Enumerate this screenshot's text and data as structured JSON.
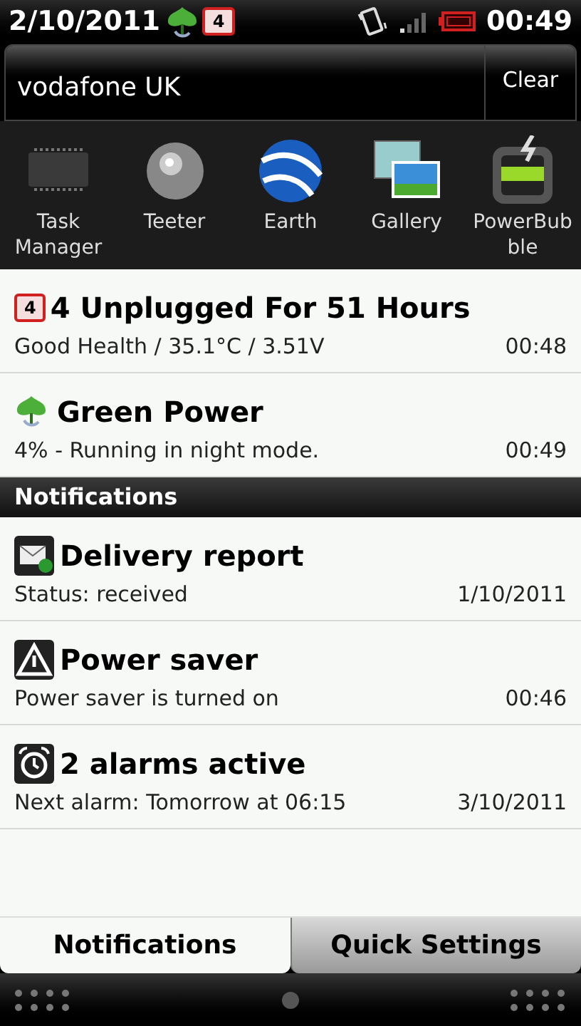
{
  "status_bar": {
    "date": "2/10/2011",
    "badge": "4",
    "time": "00:49"
  },
  "carrier": {
    "name": "vodafone UK",
    "clear": "Clear"
  },
  "apps": [
    {
      "kind": "chip",
      "label": "Task Manager"
    },
    {
      "kind": "ball",
      "label": "Teeter"
    },
    {
      "kind": "globe",
      "label": "Earth"
    },
    {
      "kind": "gallery",
      "label": "Gallery"
    },
    {
      "kind": "level",
      "label": "PowerBubble"
    }
  ],
  "ongoing": [
    {
      "kind": "battery",
      "badge": "4",
      "title": "4 Unplugged For 51 Hours",
      "detail": "Good Health / 35.1°C / 3.51V",
      "time": "00:48"
    },
    {
      "kind": "leaf",
      "title": "Green Power",
      "detail": "4% - Running in night mode.",
      "time": "00:49"
    }
  ],
  "section_header": "Notifications",
  "notifications": [
    {
      "kind": "mail",
      "title": "Delivery report",
      "detail": "Status: received",
      "time": "1/10/2011"
    },
    {
      "kind": "warning",
      "title": "Power saver",
      "detail": "Power saver is turned on",
      "time": "00:46"
    },
    {
      "kind": "alarm",
      "title": "2 alarms active",
      "detail": "Next alarm: Tomorrow at 06:15",
      "time": "3/10/2011"
    }
  ],
  "tabs": [
    {
      "label": "Notifications",
      "selected": true
    },
    {
      "label": "Quick Settings",
      "selected": false
    }
  ]
}
